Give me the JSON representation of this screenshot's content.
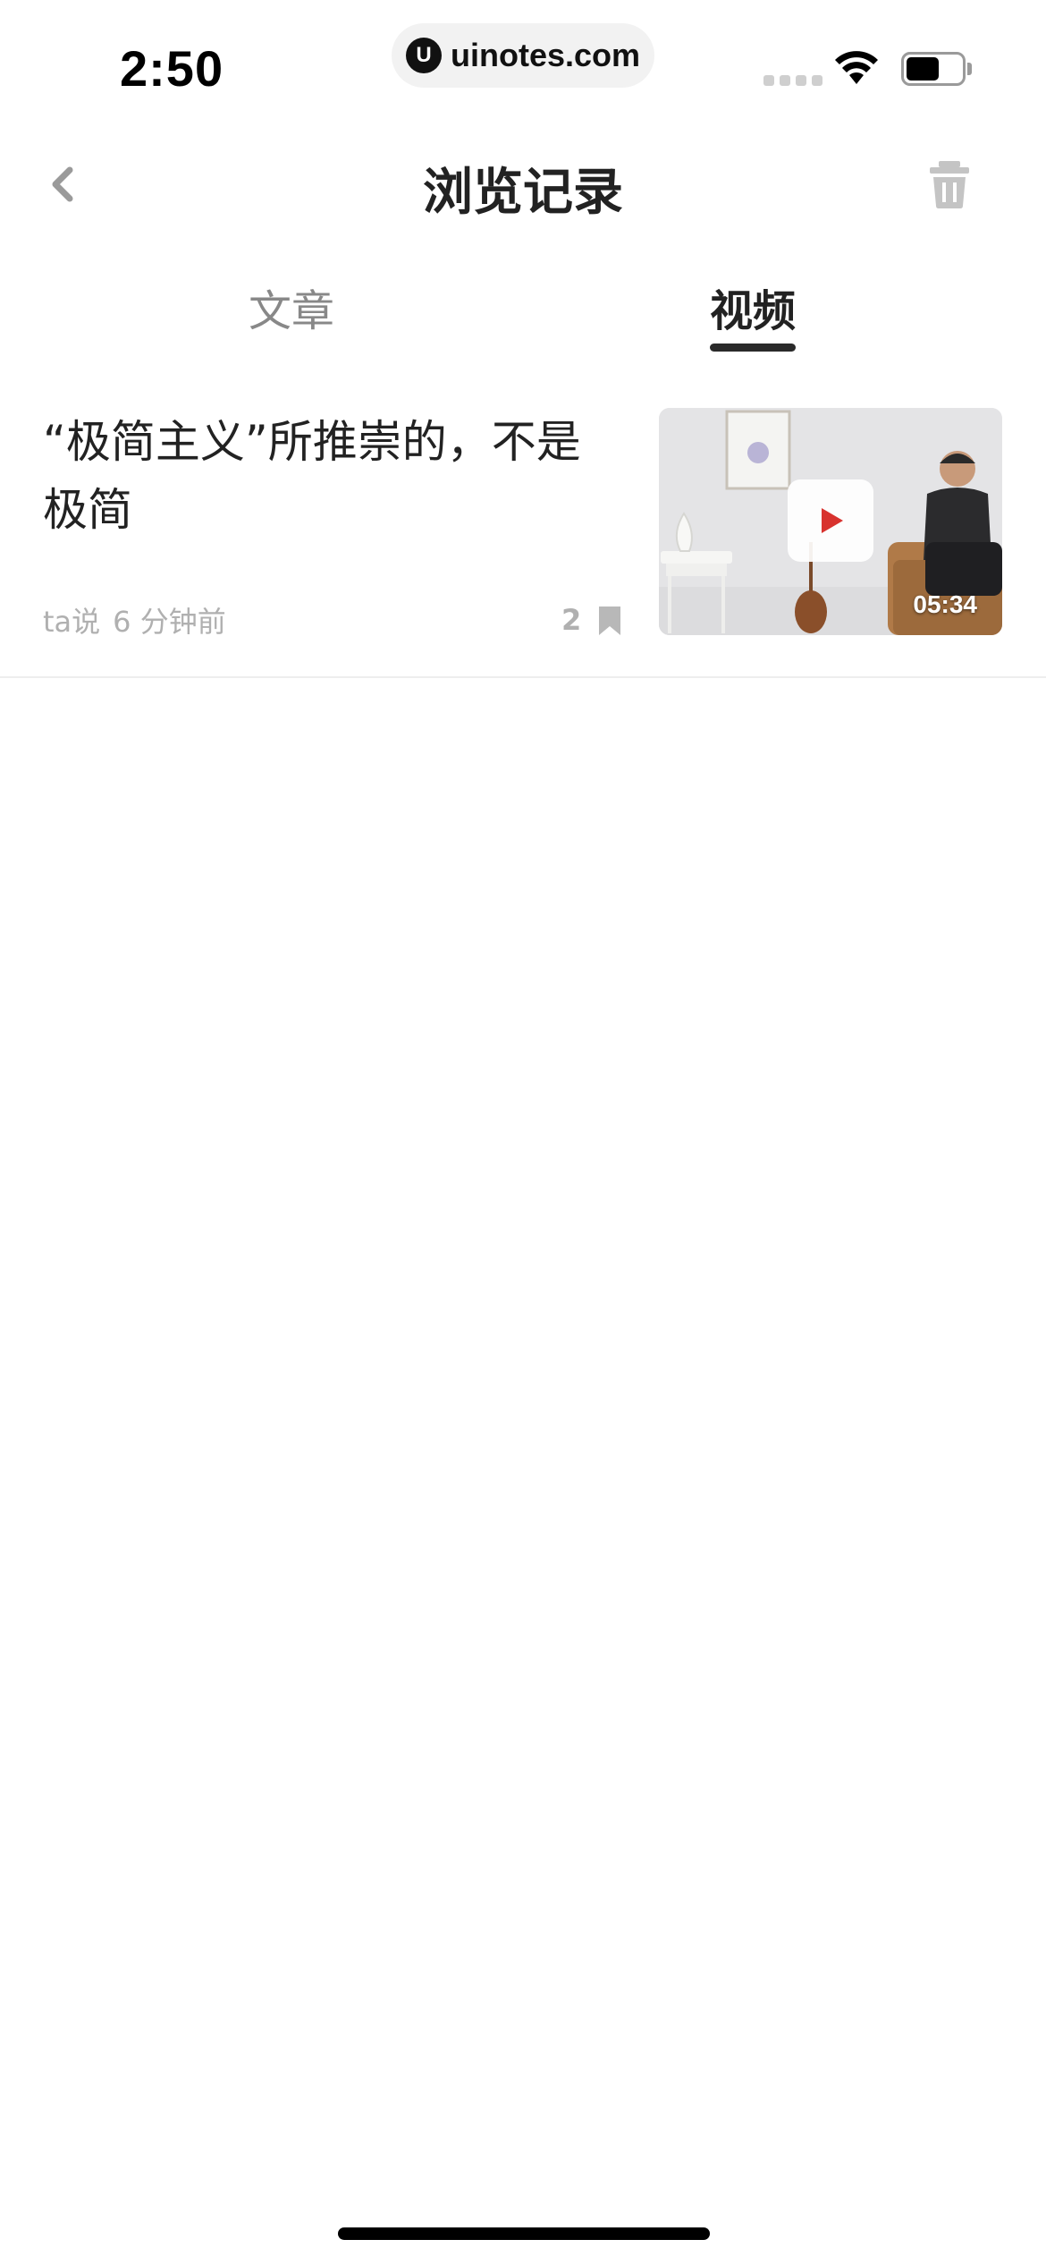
{
  "status_bar": {
    "time": "2:50",
    "url": "uinotes.com",
    "url_logo": "U"
  },
  "nav": {
    "title": "浏览记录",
    "back_icon": "chevron-left-icon",
    "delete_icon": "trash-icon"
  },
  "tabs": [
    {
      "label": "文章",
      "active": false
    },
    {
      "label": "视频",
      "active": true
    }
  ],
  "history_items": [
    {
      "title": "“极简主义”所推崇的，不是极简",
      "author": "ta说",
      "time": "6 分钟前",
      "bookmark_count": "2",
      "duration": "05:34",
      "thumbnail": "video-thumbnail-man-in-armchair-with-ukulele"
    }
  ],
  "colors": {
    "accent_play": "#d8322e",
    "text_primary": "#222222",
    "text_muted": "#b0b0b0",
    "tab_inactive": "#888888"
  }
}
